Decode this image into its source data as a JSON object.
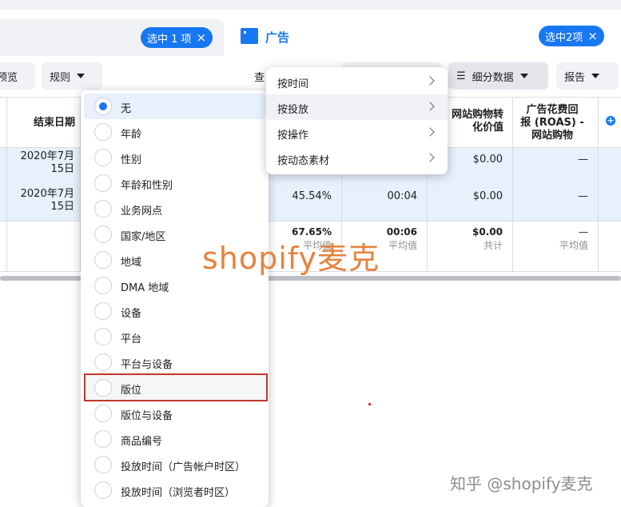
{
  "tabs": {
    "left_pill": "选中 1 项",
    "right_title": "广告",
    "right_pill": "选中2项"
  },
  "toolbar": {
    "preview": "预览",
    "rules": "规则",
    "view_partial": "查",
    "breakdown": "细分数据",
    "report": "报告"
  },
  "table": {
    "headers": {
      "end_date": "结束日期",
      "purchase_value_l1": "网站购物转",
      "purchase_value_l2": "化价值",
      "roas_l1": "广告花费回",
      "roas_l2": "报 (ROAS) -",
      "roas_l3": "网站购物"
    },
    "rows": [
      {
        "end_date_l1": "2020年7月",
        "end_date_l2": "15日",
        "value": "$0.00",
        "roas": "—"
      },
      {
        "end_date_l1": "2020年7月",
        "end_date_l2": "15日",
        "pct": "45.54%",
        "time": "00:04",
        "value": "$0.00",
        "roas": "—"
      }
    ],
    "summary": {
      "pct": "67.65%",
      "pct_sub": "平均值",
      "time": "00:06",
      "time_sub": "平均值",
      "value": "$0.00",
      "value_sub": "共计",
      "roas": "—",
      "roas_sub": "平均值"
    }
  },
  "breakdown_options": [
    {
      "label": "无",
      "selected": true
    },
    {
      "label": "年龄"
    },
    {
      "label": "性别"
    },
    {
      "label": "年龄和性别"
    },
    {
      "label": "业务网点"
    },
    {
      "label": "国家/地区"
    },
    {
      "label": "地域"
    },
    {
      "label": "DMA 地域"
    },
    {
      "label": "设备"
    },
    {
      "label": "平台"
    },
    {
      "label": "平台与设备"
    },
    {
      "label": "版位"
    },
    {
      "label": "版位与设备"
    },
    {
      "label": "商品编号"
    },
    {
      "label": "投放时间（广告帐户时区）"
    },
    {
      "label": "投放时间（浏览者时区）"
    }
  ],
  "submenu": [
    {
      "label": "按时间"
    },
    {
      "label": "按投放",
      "active": true
    },
    {
      "label": "按操作"
    },
    {
      "label": "按动态素材"
    }
  ],
  "watermark": {
    "main": "shopify麦克",
    "corner": "知乎 @shopify麦克"
  },
  "colors": {
    "accent": "#1877f2",
    "highlight_border": "#c0392b",
    "watermark": "#e8823c"
  }
}
